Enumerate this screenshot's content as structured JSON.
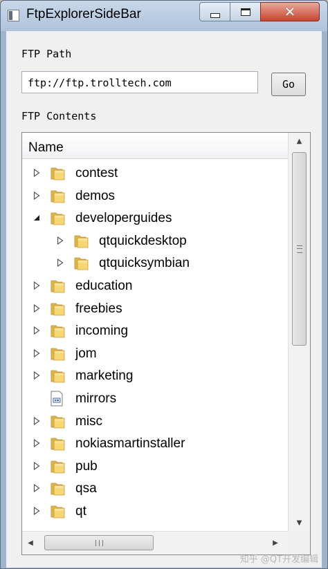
{
  "window": {
    "title": "FtpExplorerSideBar",
    "minimize_symbol": "",
    "maximize_symbol": "",
    "close_symbol": "✕"
  },
  "ftp_path": {
    "label": "FTP Path",
    "value": "ftp://ftp.trolltech.com",
    "go_label": "Go"
  },
  "contents": {
    "label": "FTP Contents",
    "column_header": "Name",
    "items": [
      {
        "label": "contest",
        "type": "folder",
        "level": 0,
        "expander": "collapsed"
      },
      {
        "label": "demos",
        "type": "folder",
        "level": 0,
        "expander": "collapsed"
      },
      {
        "label": "developerguides",
        "type": "folder",
        "level": 0,
        "expander": "expanded"
      },
      {
        "label": "qtquickdesktop",
        "type": "folder",
        "level": 1,
        "expander": "collapsed"
      },
      {
        "label": "qtquicksymbian",
        "type": "folder",
        "level": 1,
        "expander": "collapsed"
      },
      {
        "label": "education",
        "type": "folder",
        "level": 0,
        "expander": "collapsed"
      },
      {
        "label": "freebies",
        "type": "folder",
        "level": 0,
        "expander": "collapsed"
      },
      {
        "label": "incoming",
        "type": "folder",
        "level": 0,
        "expander": "collapsed"
      },
      {
        "label": "jom",
        "type": "folder",
        "level": 0,
        "expander": "collapsed"
      },
      {
        "label": "marketing",
        "type": "folder",
        "level": 0,
        "expander": "collapsed"
      },
      {
        "label": "mirrors",
        "type": "file",
        "level": 0,
        "expander": "none"
      },
      {
        "label": "misc",
        "type": "folder",
        "level": 0,
        "expander": "collapsed"
      },
      {
        "label": "nokiasmartinstaller",
        "type": "folder",
        "level": 0,
        "expander": "collapsed"
      },
      {
        "label": "pub",
        "type": "folder",
        "level": 0,
        "expander": "collapsed"
      },
      {
        "label": "qsa",
        "type": "folder",
        "level": 0,
        "expander": "collapsed"
      },
      {
        "label": "qt",
        "type": "folder",
        "level": 0,
        "expander": "collapsed"
      }
    ]
  },
  "watermark": "知乎 @QT开发编辑",
  "colors": {
    "folder_front": "#f7d774",
    "folder_back": "#e2b54a",
    "titlebar": "#b9cbe0"
  }
}
